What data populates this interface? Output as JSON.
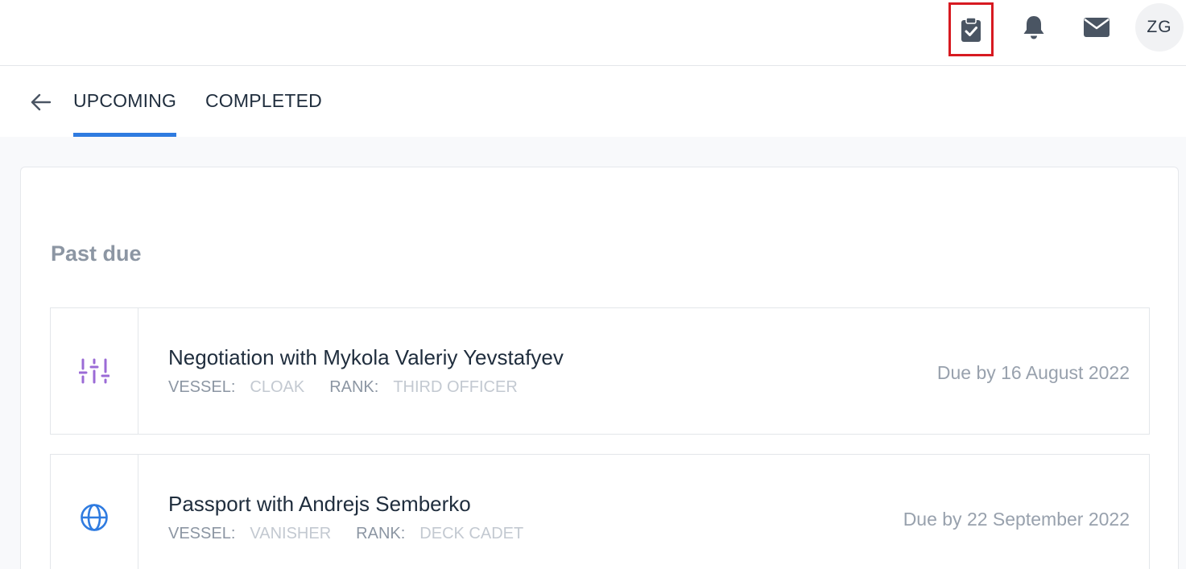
{
  "header": {
    "icons": [
      "clipboard-check-icon",
      "bell-icon",
      "mail-icon"
    ],
    "avatar_initials": "ZG",
    "highlight_color": "#d71a21"
  },
  "tabs": [
    {
      "label": "UPCOMING",
      "active": true
    },
    {
      "label": "COMPLETED",
      "active": false
    }
  ],
  "accent_color": "#2f7be0",
  "main": {
    "section_title": "Past due",
    "tasks": [
      {
        "icon": "sliders-icon",
        "icon_color": "#9b6bd6",
        "title": "Negotiation with Mykola Valeriy Yevstafyev",
        "vessel_label": "VESSEL:",
        "vessel": "CLOAK",
        "rank_label": "RANK:",
        "rank": "THIRD OFFICER",
        "due": "Due by 16 August 2022"
      },
      {
        "icon": "globe-icon",
        "icon_color": "#2f7be0",
        "title": "Passport with Andrejs Semberko",
        "vessel_label": "VESSEL:",
        "vessel": "VANISHER",
        "rank_label": "RANK:",
        "rank": "DECK CADET",
        "due": "Due by 22 September 2022"
      }
    ]
  }
}
